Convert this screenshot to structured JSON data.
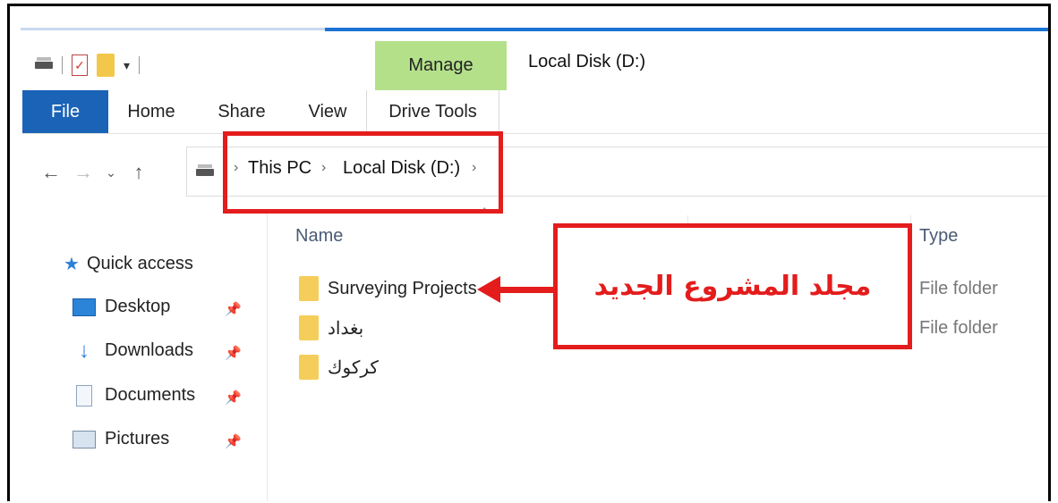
{
  "window": {
    "title": "Local Disk (D:)"
  },
  "ribbon": {
    "contextual_tab": "Manage",
    "tabs": [
      "File",
      "Home",
      "Share",
      "View",
      "Drive Tools"
    ]
  },
  "nav": {
    "breadcrumb": [
      "This PC",
      "Local Disk (D:)"
    ]
  },
  "nav_pane": {
    "quick_access": "Quick access",
    "items": [
      "Desktop",
      "Downloads",
      "Documents",
      "Pictures"
    ]
  },
  "file_list": {
    "columns": {
      "name": "Name",
      "type": "Type"
    },
    "rows": [
      {
        "name": "Surveying Projects",
        "type": "File folder"
      },
      {
        "name": "بغداد",
        "type": "File folder"
      },
      {
        "name": "كركوك",
        "type": ""
      }
    ]
  },
  "annotation": {
    "text": "مجلد المشروع الجديد",
    "color": "#e41c1c"
  },
  "colors": {
    "file_tab": "#1b63b7",
    "manage_tab": "#b4e08a",
    "highlight": "#e41c1c"
  }
}
